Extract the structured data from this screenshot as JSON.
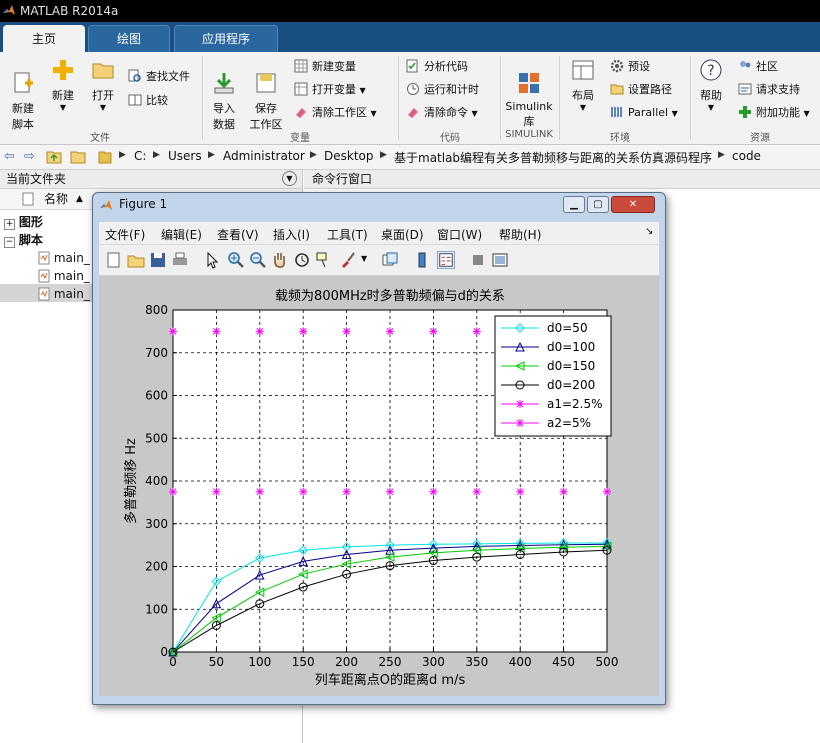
{
  "app": {
    "title": "MATLAB R2014a"
  },
  "tabs": [
    {
      "label": "主页"
    },
    {
      "label": "绘图"
    },
    {
      "label": "应用程序"
    }
  ],
  "ribbon": {
    "file": {
      "new_script": "新建\n脚本",
      "new": "新建",
      "open": "打开",
      "find_files": "查找文件",
      "compare": "比较",
      "group": "文件"
    },
    "variable": {
      "import": "导入\n数据",
      "save_ws": "保存\n工作区",
      "new_var": "新建变量",
      "open_var": "打开变量",
      "clear_ws": "清除工作区",
      "group": "变量"
    },
    "code": {
      "analyze": "分析代码",
      "run_time": "运行和计时",
      "clear_cmd": "清除命令",
      "group": "代码"
    },
    "simulink": {
      "lib": "Simulink\n库",
      "group": "SIMULINK"
    },
    "env": {
      "layout": "布局",
      "prefs": "预设",
      "set_path": "设置路径",
      "parallel": "Parallel",
      "group": "环境"
    },
    "resources": {
      "help": "帮助",
      "community": "社区",
      "support": "请求支持",
      "addons": "附加功能",
      "group": "资源"
    }
  },
  "address": {
    "segments": [
      "C:",
      "Users",
      "Administrator",
      "Desktop",
      "基于matlab编程有关多普勒频移与距离的关系仿真源码程序",
      "code"
    ]
  },
  "left_panel": {
    "title": "当前文件夹",
    "col_name": "名称",
    "groups": [
      {
        "label": "图形"
      },
      {
        "label": "脚本"
      }
    ],
    "files": [
      "main_",
      "main_",
      "main_"
    ]
  },
  "right_panel": {
    "title": "命令行窗口"
  },
  "figure": {
    "title": "Figure 1",
    "menu": [
      "文件(F)",
      "编辑(E)",
      "查看(V)",
      "插入(I)",
      "工具(T)",
      "桌面(D)",
      "窗口(W)",
      "帮助(H)"
    ]
  },
  "colors": {
    "tabbar": "#1a4f84",
    "d0_50": "#00e5e5",
    "d0_100": "#00008b",
    "d0_150": "#00cc00",
    "d0_200": "#000000",
    "a_lines": "#ff00ff"
  },
  "chart_data": {
    "type": "line",
    "title": "载频为800MHz时多普勒频偏与d的关系",
    "xlabel": "列车距离点O的距离d m/s",
    "ylabel": "多普勒频移 Hz",
    "xlim": [
      0,
      500
    ],
    "ylim": [
      0,
      800
    ],
    "xticks": [
      0,
      50,
      100,
      150,
      200,
      250,
      300,
      350,
      400,
      450,
      500
    ],
    "yticks": [
      0,
      100,
      200,
      300,
      400,
      500,
      600,
      700,
      800
    ],
    "grid": true,
    "legend_position": "top-right",
    "x": [
      0,
      50,
      100,
      150,
      200,
      250,
      300,
      350,
      400,
      450,
      500
    ],
    "series": [
      {
        "name": "d0=50",
        "marker": "diamond",
        "color": "#00e5e5",
        "values": [
          0,
          165,
          220,
          238,
          246,
          250,
          252,
          253,
          254,
          255,
          255
        ]
      },
      {
        "name": "d0=100",
        "marker": "triangle",
        "color": "#00008b",
        "values": [
          0,
          113,
          180,
          212,
          228,
          238,
          243,
          247,
          249,
          251,
          252
        ]
      },
      {
        "name": "d0=150",
        "marker": "triangle-left",
        "color": "#00cc00",
        "values": [
          0,
          80,
          140,
          182,
          206,
          222,
          232,
          238,
          242,
          245,
          247
        ]
      },
      {
        "name": "d0=200",
        "marker": "circle",
        "color": "#000000",
        "values": [
          0,
          62,
          113,
          152,
          182,
          202,
          214,
          222,
          228,
          234,
          238
        ]
      },
      {
        "name": "a1=2.5%",
        "marker": "star",
        "color": "#ff00ff",
        "line": "none",
        "values": [
          375,
          375,
          375,
          375,
          375,
          375,
          375,
          375,
          375,
          375,
          375
        ]
      },
      {
        "name": "a2=5%",
        "marker": "star",
        "color": "#ff00ff",
        "line": "none",
        "values": [
          750,
          750,
          750,
          750,
          750,
          750,
          750,
          750,
          750,
          750,
          750
        ]
      }
    ]
  }
}
